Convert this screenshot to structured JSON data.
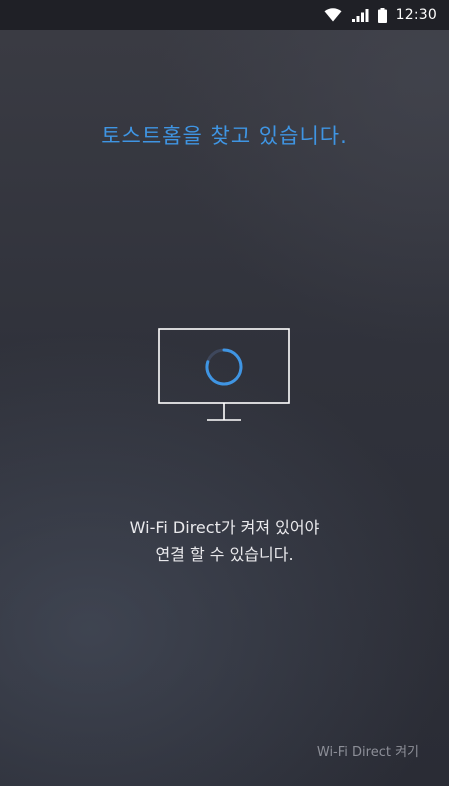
{
  "status_bar": {
    "time": "12:30",
    "icons": [
      "wifi-icon",
      "signal-icon",
      "battery-icon"
    ]
  },
  "search_title": "토스트홈을 찾고 있습니다.",
  "monitor": {
    "icon": "monitor-icon",
    "spinner": "loading-spinner"
  },
  "message": {
    "line1": "Wi-Fi Direct가 켜져 있어야",
    "line2": "연결 할 수 있습니다."
  },
  "wifi_direct_button": "Wi-Fi Direct 켜기",
  "colors": {
    "accent": "#3f95e3",
    "background": "#30323b",
    "status_bar": "#1f2026"
  }
}
